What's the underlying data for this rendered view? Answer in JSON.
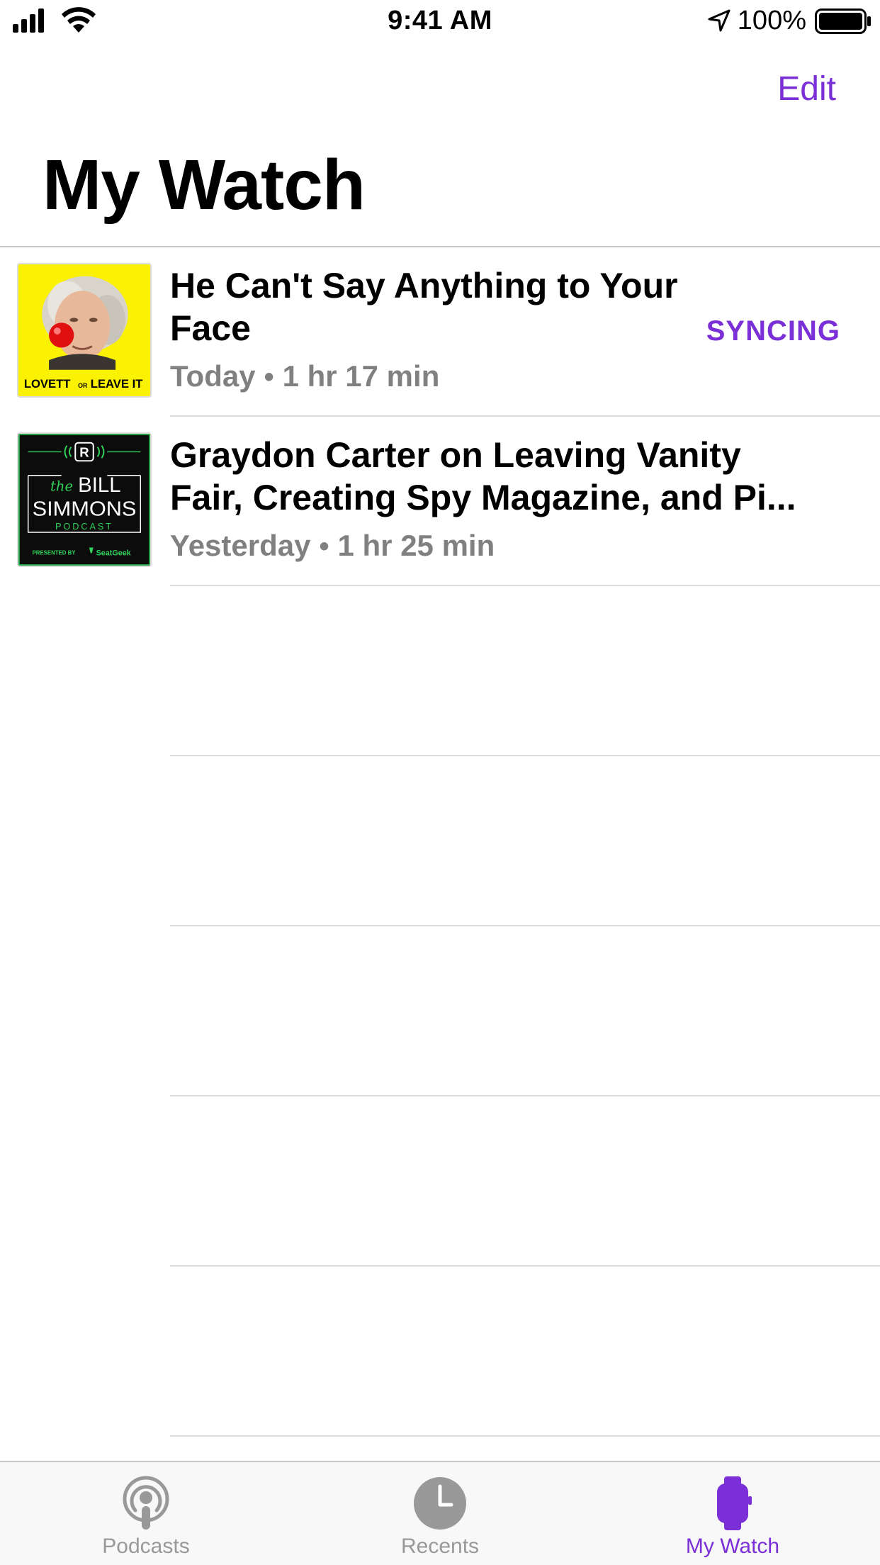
{
  "status_bar": {
    "time": "9:41 AM",
    "battery": "100%"
  },
  "nav": {
    "edit_label": "Edit",
    "title": "My Watch"
  },
  "episodes": [
    {
      "title": "He Can't Say Anything to Your Face",
      "date": "Today",
      "separator": "•",
      "duration": "1 hr 17 min",
      "status": "SYNCING",
      "artwork": {
        "name": "lovett-or-leave-it-artwork",
        "text_left": "LOVETT",
        "text_mid": "OR",
        "text_right": "LEAVE IT",
        "background": "#fbf102"
      }
    },
    {
      "title": "Graydon Carter on Leaving Vanity Fair, Creating Spy Magazine, and Pi...",
      "date": "Yesterday",
      "separator": "•",
      "duration": "1 hr 25 min",
      "artwork": {
        "name": "bill-simmons-podcast-artwork",
        "logo_letter": "R",
        "text_the": "the",
        "text_bill": "BILL",
        "text_simmons": "SIMMONS",
        "text_podcast": "PODCAST",
        "text_presented": "PRESENTED BY",
        "text_sponsor": "SeatGeek",
        "background": "#0c0c0c",
        "accent": "#30d158"
      }
    }
  ],
  "tabs": [
    {
      "label": "Podcasts",
      "icon": "podcasts-icon",
      "active": false
    },
    {
      "label": "Recents",
      "icon": "clock-icon",
      "active": false
    },
    {
      "label": "My Watch",
      "icon": "watch-icon",
      "active": true
    }
  ],
  "colors": {
    "accent": "#7b2fd6",
    "secondary_text": "#808080",
    "separator": "#dcdcdc",
    "tab_bar": "#f8f8f8",
    "inactive_tab": "#999999"
  }
}
